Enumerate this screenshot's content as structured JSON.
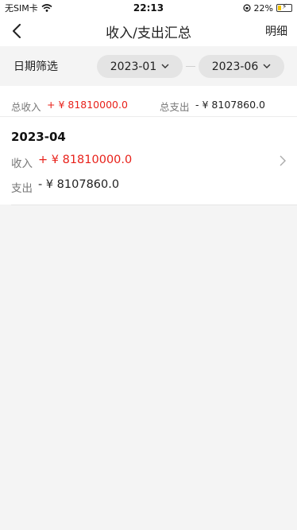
{
  "status": {
    "carrier": "无SIM卡",
    "time": "22:13",
    "battery": "22%"
  },
  "nav": {
    "title": "收入/支出汇总",
    "right_label": "明细"
  },
  "filter": {
    "label": "日期筛选",
    "start": "2023-01",
    "end": "2023-06"
  },
  "totals": {
    "income_label": "总收入",
    "income_value": "+ ¥ 81810000.0",
    "expense_label": "总支出",
    "expense_value": "- ¥ 8107860.0"
  },
  "records": [
    {
      "month": "2023-04",
      "income_label": "收入",
      "income_value": "+ ¥ 81810000.0",
      "expense_label": "支出",
      "expense_value": "- ¥ 8107860.0"
    }
  ],
  "colors": {
    "income": "#e8211a",
    "background": "#f4f4f4"
  }
}
